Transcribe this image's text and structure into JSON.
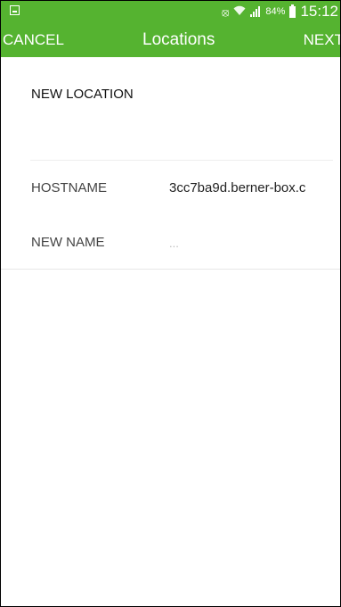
{
  "status_bar": {
    "battery": "84%",
    "time": "15:12",
    "icons": [
      "screenshot-icon",
      "mute-vibrate-icon",
      "wifi-icon",
      "signal-icon",
      "battery-icon"
    ]
  },
  "action_bar": {
    "cancel_label": "CANCEL",
    "title": "Locations",
    "next_label": "NEXT"
  },
  "form": {
    "section_title": "NEW LOCATION",
    "hostname": {
      "label": "HOSTNAME",
      "value": "3cc7ba9d.berner-box.c"
    },
    "new_name": {
      "label": "NEW NAME",
      "placeholder": "...",
      "value": ""
    }
  },
  "colors": {
    "brand_green": "#55b330",
    "background": "#ffffff",
    "divider": "#eeeeee"
  }
}
